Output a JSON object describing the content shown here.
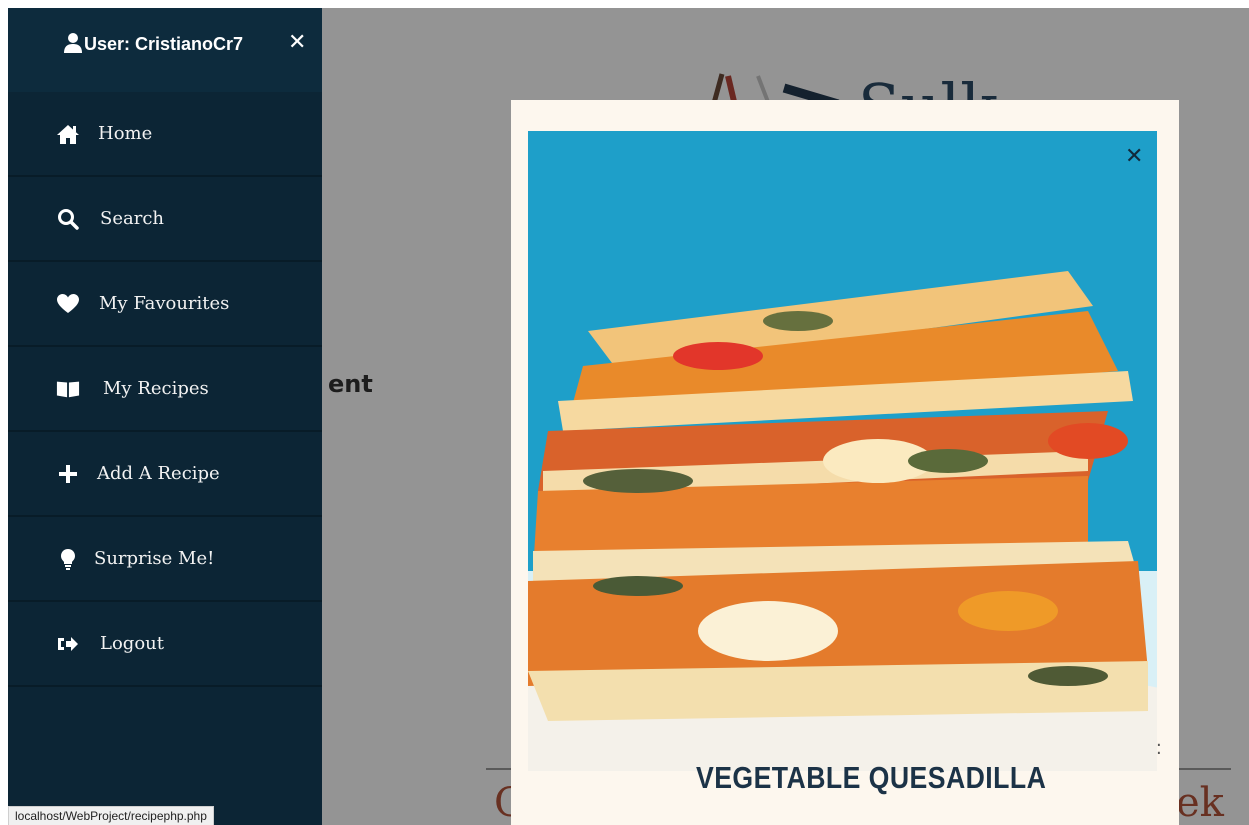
{
  "sidebar": {
    "user_label": "User: CristianoCr7",
    "close_glyph": "✕",
    "items": [
      {
        "label": "Home",
        "icon": "home-icon"
      },
      {
        "label": "Search",
        "icon": "search-icon"
      },
      {
        "label": "My Favourites",
        "icon": "heart-icon"
      },
      {
        "label": "My Recipes",
        "icon": "book-icon"
      },
      {
        "label": "Add A Recipe",
        "icon": "plus-icon"
      },
      {
        "label": "Surprise Me!",
        "icon": "lightbulb-icon"
      },
      {
        "label": "Logout",
        "icon": "logout-icon"
      }
    ]
  },
  "background": {
    "partial_text": "ent",
    "partial_left": "C",
    "partial_right": "ek"
  },
  "modal": {
    "close_glyph": "✕",
    "title": "VEGETABLE QUESADILLA",
    "image": "quesadilla-photo"
  },
  "status_bar": {
    "url": "localhost/WebProject/recipephp.php"
  },
  "colors": {
    "sidebar": "#0c2535",
    "modal_bg": "#fdf7ee",
    "photo_bg": "#1fa3cc",
    "title": "#1c3347"
  }
}
